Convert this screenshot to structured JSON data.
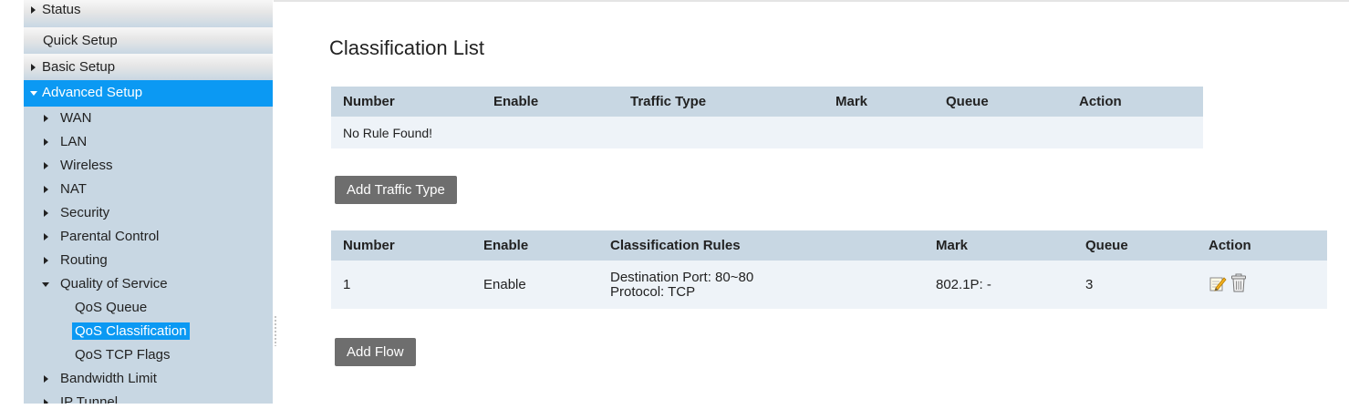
{
  "sidebar": {
    "status": "Status",
    "quick_setup": "Quick Setup",
    "basic_setup": "Basic Setup",
    "advanced_setup": "Advanced Setup",
    "items": [
      "WAN",
      "LAN",
      "Wireless",
      "NAT",
      "Security",
      "Parental Control",
      "Routing"
    ],
    "qos": "Quality of Service",
    "qos_children": [
      "QoS Queue",
      "QoS Classification",
      "QoS TCP Flags"
    ],
    "after_items": [
      "Bandwidth Limit",
      "IP Tunnel"
    ]
  },
  "main": {
    "title": "Classification List",
    "traffic_table": {
      "headers": [
        "Number",
        "Enable",
        "Traffic Type",
        "Mark",
        "Queue",
        "Action"
      ],
      "empty_text": "No Rule Found!"
    },
    "add_traffic_button": "Add Traffic Type",
    "flow_table": {
      "headers": [
        "Number",
        "Enable",
        "Classification Rules",
        "Mark",
        "Queue",
        "Action"
      ],
      "rows": [
        {
          "number": "1",
          "enable": "Enable",
          "rule_line1": "Destination Port: 80~80",
          "rule_line2": "Protocol: TCP",
          "mark": "802.1P: -",
          "queue": "3"
        }
      ]
    },
    "add_flow_button": "Add Flow"
  },
  "colors": {
    "sidebar_bg": "#c8d7e3",
    "active_blue": "#0b99f3",
    "button_gray": "#6e6e6e"
  },
  "icons": [
    "edit-icon",
    "trash-icon"
  ]
}
